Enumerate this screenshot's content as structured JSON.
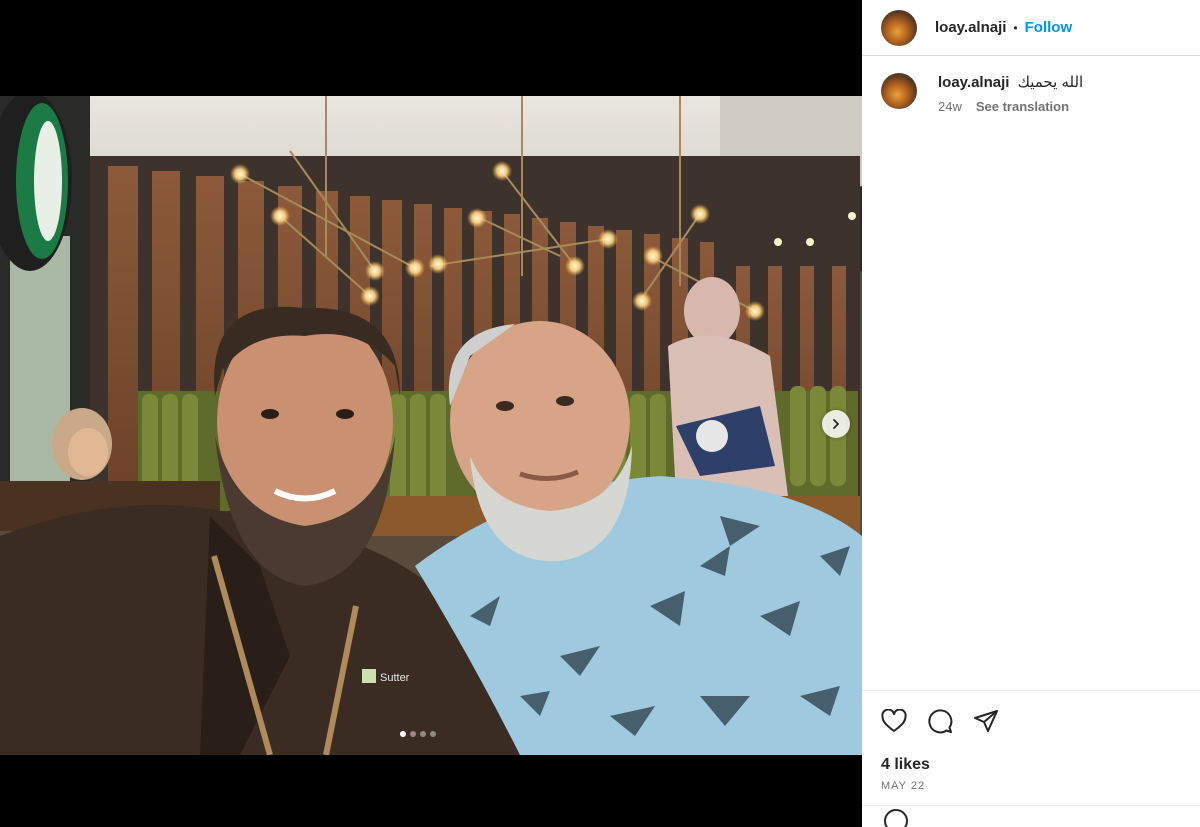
{
  "post": {
    "username": "loay.alnaji",
    "separator": "•",
    "follow_label": "Follow"
  },
  "caption": {
    "username": "loay.alnaji",
    "text": "الله يحميك",
    "age": "24w",
    "see_translation": "See translation"
  },
  "engagement": {
    "likes": "4 likes",
    "date": "MAY 22"
  },
  "carousel": {
    "slide_count": 4,
    "active_slide": 1
  },
  "icons": {
    "like": "heart-icon",
    "comment": "comment-icon",
    "share": "send-icon",
    "next": "chevron-right-icon"
  },
  "colors": {
    "accent": "#0095f6",
    "text": "#262626",
    "muted": "#737373"
  }
}
